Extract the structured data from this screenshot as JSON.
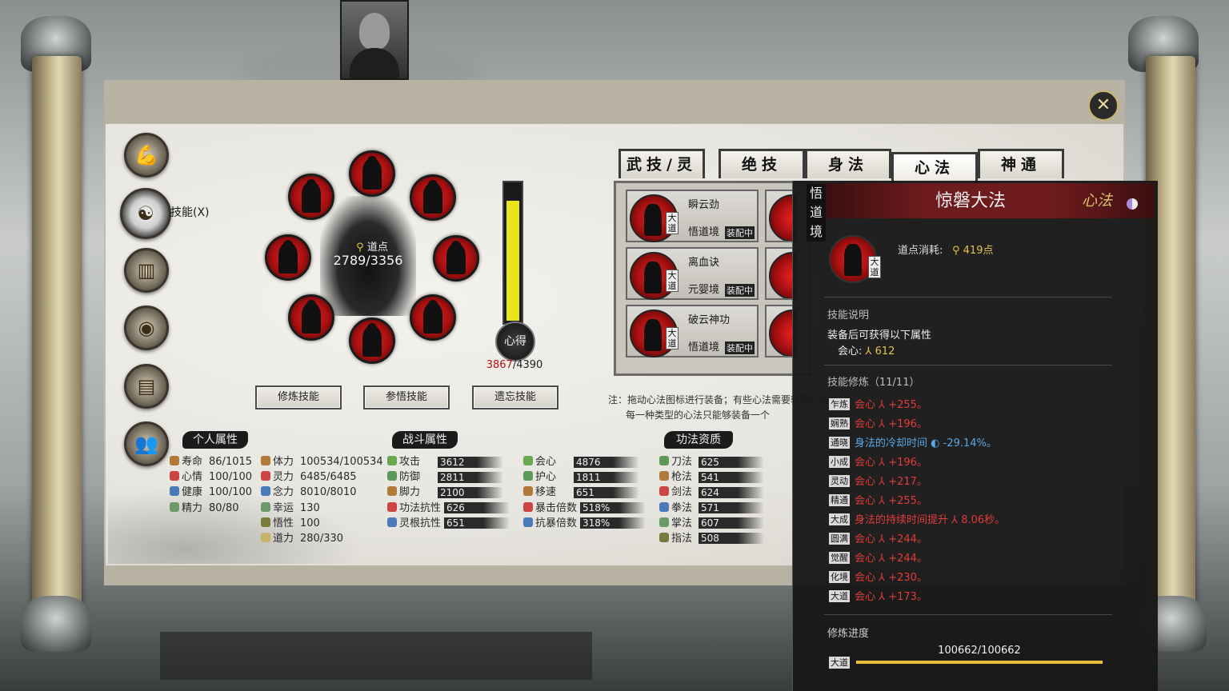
{
  "nav": {
    "active_label": "技能(X)"
  },
  "wheel": {
    "dao_label": "道点",
    "dao_value": "2789/3356"
  },
  "xinde": {
    "label": "心得",
    "current": "3867",
    "sep_max": "/4390",
    "fill_fraction": 0.88
  },
  "actions": {
    "train": "修炼技能",
    "comprehend": "参悟技能",
    "forget": "遗忘技能"
  },
  "tabs": [
    "武技/灵技",
    "绝技",
    "身法",
    "心法",
    "神通"
  ],
  "selected_tab": "心法",
  "skill_list": [
    {
      "name": "瞬云劲",
      "level": "悟道境",
      "tag": "大道",
      "status": "装配中"
    },
    {
      "name": "离血诀",
      "level": "元婴境",
      "tag": "大道",
      "status": "装配中"
    },
    {
      "name": "破云神功",
      "level": "悟道境",
      "tag": "大道",
      "status": "装配中"
    }
  ],
  "notes": {
    "line1": "注：拖动心法图标进行装备；有些心法需要较高的道点",
    "line2": "每一种类型的心法只能够装备一个"
  },
  "sections": {
    "personal": "个人属性",
    "combat": "战斗属性",
    "aptitude": "功法资质"
  },
  "personal_attrs": [
    {
      "name": "寿命",
      "value": "86/1015"
    },
    {
      "name": "心情",
      "value": "100/100"
    },
    {
      "name": "健康",
      "value": "100/100"
    },
    {
      "name": "精力",
      "value": "80/80"
    }
  ],
  "personal_attrs2": [
    {
      "name": "体力",
      "value": "100534/100534"
    },
    {
      "name": "灵力",
      "value": "6485/6485"
    },
    {
      "name": "念力",
      "value": "8010/8010"
    },
    {
      "name": "幸运",
      "value": "130"
    },
    {
      "name": "悟性",
      "value": "100"
    },
    {
      "name": "道力",
      "value": "280/330"
    }
  ],
  "combat_attrs": [
    {
      "name": "攻击",
      "value": "3612"
    },
    {
      "name": "防御",
      "value": "2811"
    },
    {
      "name": "脚力",
      "value": "2100"
    },
    {
      "name": "功法抗性",
      "value": "626"
    },
    {
      "name": "灵根抗性",
      "value": "651"
    }
  ],
  "combat_attrs2": [
    {
      "name": "会心",
      "value": "4876"
    },
    {
      "name": "护心",
      "value": "1811"
    },
    {
      "name": "移速",
      "value": "651"
    },
    {
      "name": "暴击倍数",
      "value": "518%"
    },
    {
      "name": "抗暴倍数",
      "value": "318%"
    }
  ],
  "aptitude_attrs": [
    {
      "name": "刀法",
      "value": "625"
    },
    {
      "name": "枪法",
      "value": "541"
    },
    {
      "name": "剑法",
      "value": "624"
    },
    {
      "name": "拳法",
      "value": "571"
    },
    {
      "name": "掌法",
      "value": "607"
    },
    {
      "name": "指法",
      "value": "508"
    }
  ],
  "tooltip": {
    "realm": "悟道境",
    "title": "惊磐大法",
    "type": "心法",
    "orb_tag": "大道",
    "cost_label": "道点消耗:",
    "cost_value": "419点",
    "desc_header": "技能说明",
    "desc_text": "装备后可获得以下属性",
    "desc_stat_name": "会心:",
    "desc_stat_value": "612",
    "train_header": "技能修炼（11/11）",
    "levels": [
      {
        "badge": "乍炼",
        "text": "会心",
        "value": "+255。",
        "color": "red"
      },
      {
        "badge": "娴熟",
        "text": "会心",
        "value": "+196。",
        "color": "red"
      },
      {
        "badge": "通晓",
        "text": "身法的冷却时间",
        "value": "-29.14%。",
        "color": "blue"
      },
      {
        "badge": "小成",
        "text": "会心",
        "value": "+196。",
        "color": "red"
      },
      {
        "badge": "灵动",
        "text": "会心",
        "value": "+217。",
        "color": "red"
      },
      {
        "badge": "精通",
        "text": "会心",
        "value": "+255。",
        "color": "red"
      },
      {
        "badge": "大成",
        "text": "身法的持续时间提升",
        "value": "8.06秒。",
        "color": "red"
      },
      {
        "badge": "圆满",
        "text": "会心",
        "value": "+244。",
        "color": "red"
      },
      {
        "badge": "觉醒",
        "text": "会心",
        "value": "+244。",
        "color": "red"
      },
      {
        "badge": "化境",
        "text": "会心",
        "value": "+230。",
        "color": "red"
      },
      {
        "badge": "大道",
        "text": "会心",
        "value": "+173。",
        "color": "red"
      }
    ],
    "progress_label": "修炼进度",
    "progress_badge": "大道",
    "progress_value": "100662/100662",
    "progress_fraction": 1.0
  }
}
